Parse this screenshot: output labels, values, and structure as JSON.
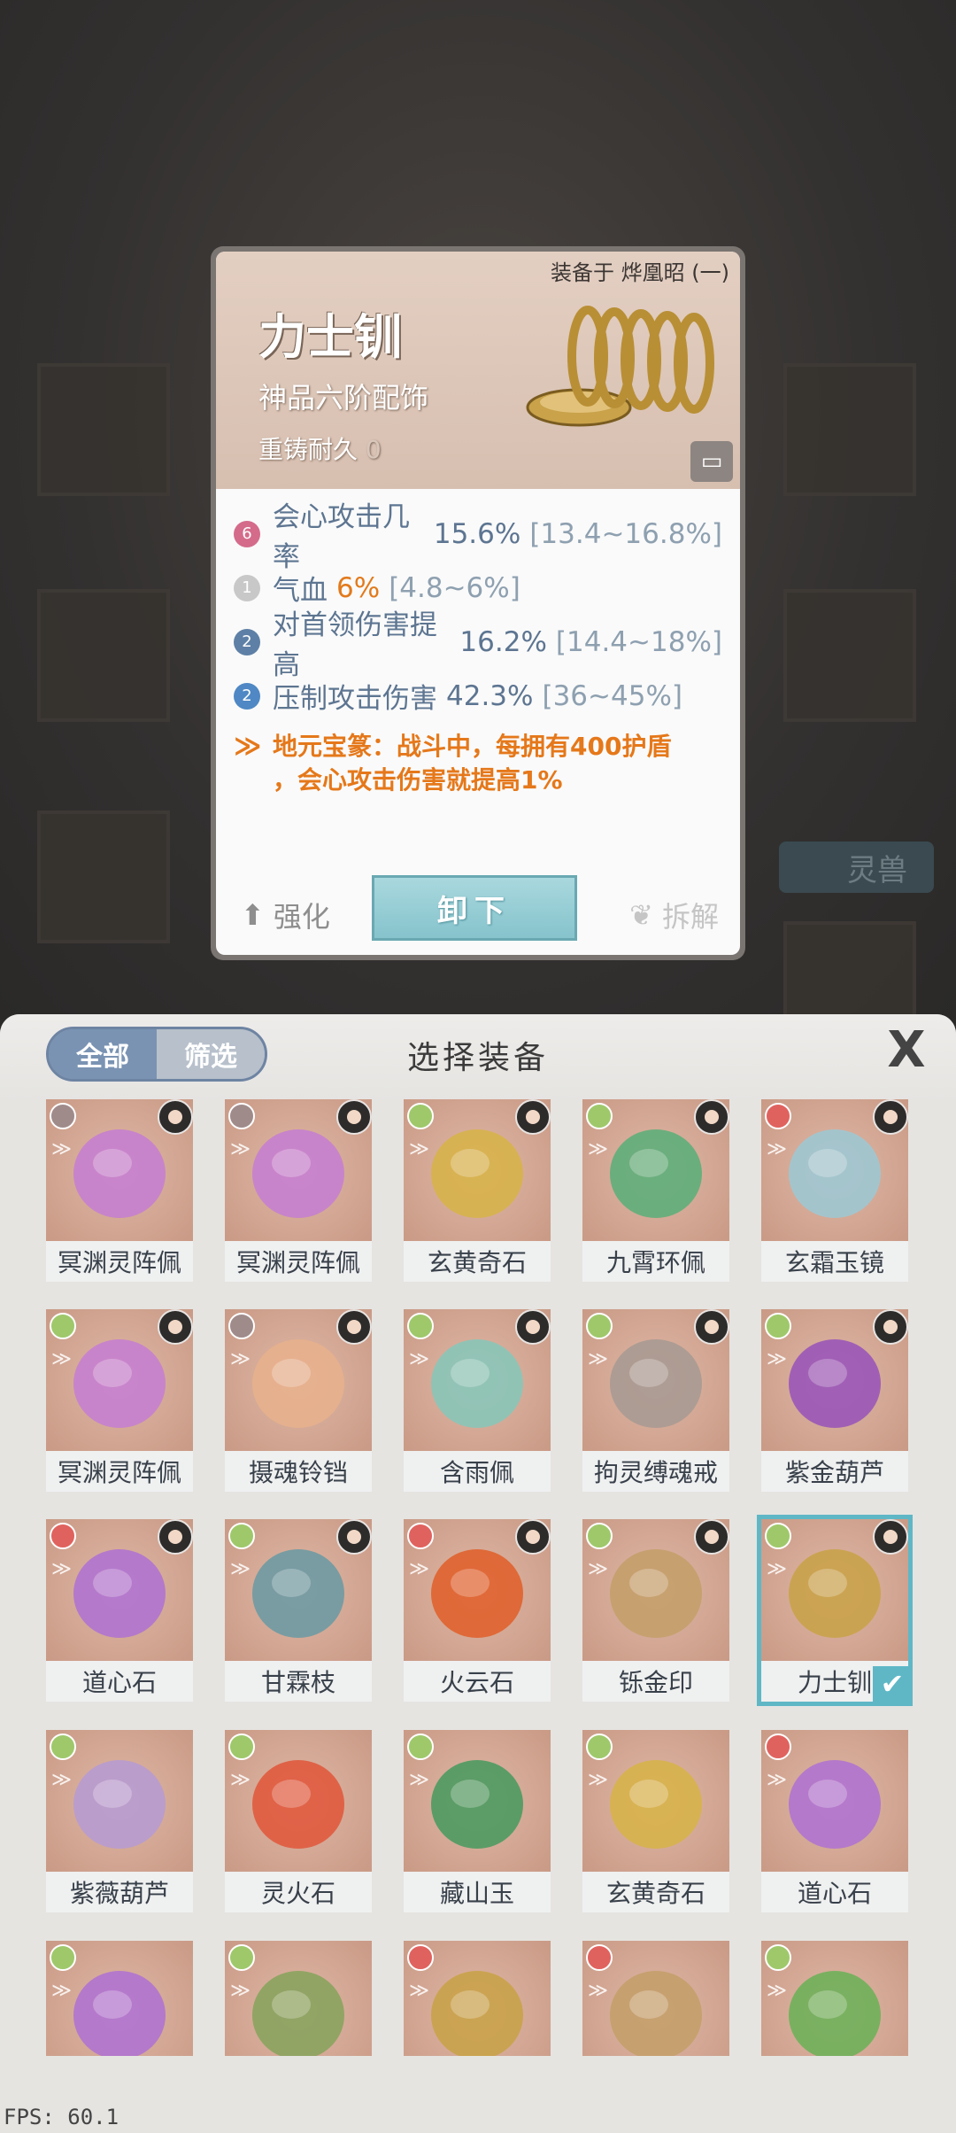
{
  "card": {
    "equipped_on": "装备于 烨凰昭 (一)",
    "name": "力士钏",
    "grade": "神品六阶配饰",
    "durability_label": "重铸耐久",
    "durability_value": "0",
    "stats": [
      {
        "badge": "6",
        "badge_color": "#d46b8b",
        "name": "会心攻击几率",
        "value": "15.6%",
        "range": "[13.4~16.8%]",
        "highlight": false
      },
      {
        "badge": "1",
        "badge_color": "#c8c8c8",
        "name": "气血",
        "value": "6%",
        "range": "[4.8~6%]",
        "highlight": true
      },
      {
        "badge": "2",
        "badge_color": "#5e80a6",
        "name": "对首领伤害提高",
        "value": "16.2%",
        "range": "[14.4~18%]",
        "highlight": false
      },
      {
        "badge": "2",
        "badge_color": "#4f88c4",
        "name": "压制攻击伤害",
        "value": "42.3%",
        "range": "[36~45%]",
        "highlight": false
      }
    ],
    "special_line1": "地元宝篆：战斗中，每拥有400护盾",
    "special_line2": "，会心攻击伤害就提高1%",
    "btn_strengthen": "强化",
    "btn_unequip": "卸下",
    "btn_dismantle": "拆解"
  },
  "background": {
    "pet_label": "灵兽"
  },
  "panel": {
    "tab_all": "全部",
    "tab_filter": "筛选",
    "title": "选择装备",
    "close": "X",
    "items": [
      {
        "name": "冥渊灵阵佩",
        "q": "#a08b8b",
        "art": "#c57fcf",
        "owner": true,
        "chest": false
      },
      {
        "name": "冥渊灵阵佩",
        "q": "#a08b8b",
        "art": "#c57fcf",
        "owner": true,
        "chest": false
      },
      {
        "name": "玄黄奇石",
        "q": "#9fc86b",
        "art": "#d7b24a",
        "owner": true,
        "chest": false
      },
      {
        "name": "九霄环佩",
        "q": "#9fc86b",
        "art": "#5fae7a",
        "owner": true,
        "chest": false
      },
      {
        "name": "玄霜玉镜",
        "q": "#e0625e",
        "art": "#9ec7d2",
        "owner": true,
        "chest": false
      },
      {
        "name": "冥渊灵阵佩",
        "q": "#9fc86b",
        "art": "#c57fcf",
        "owner": true,
        "chest": false
      },
      {
        "name": "摄魂铃铛",
        "q": "#a08b8b",
        "art": "#e7b08d",
        "owner": true,
        "chest": false
      },
      {
        "name": "含雨佩",
        "q": "#9fc86b",
        "art": "#8ac5b8",
        "owner": true,
        "chest": false
      },
      {
        "name": "拘灵缚魂戒",
        "q": "#9fc86b",
        "art": "#a89a92",
        "owner": true,
        "chest": false
      },
      {
        "name": "紫金葫芦",
        "q": "#9fc86b",
        "art": "#9a56b8",
        "owner": true,
        "chest": true
      },
      {
        "name": "道心石",
        "q": "#e0625e",
        "art": "#b073d0",
        "owner": true,
        "chest": false
      },
      {
        "name": "甘霖枝",
        "q": "#9fc86b",
        "art": "#6e9aa3",
        "owner": true,
        "chest": false
      },
      {
        "name": "火云石",
        "q": "#e0625e",
        "art": "#e0622e",
        "owner": true,
        "chest": true
      },
      {
        "name": "铄金印",
        "q": "#9fc86b",
        "art": "#c49e6a",
        "owner": true,
        "chest": false
      },
      {
        "name": "力士钏",
        "q": "#9fc86b",
        "art": "#c9a24a",
        "owner": true,
        "chest": true,
        "selected": true
      },
      {
        "name": "紫薇葫芦",
        "q": "#9fc86b",
        "art": "#b79bd0",
        "owner": false,
        "chest": false
      },
      {
        "name": "灵火石",
        "q": "#9fc86b",
        "art": "#e05a3e",
        "owner": false,
        "chest": false
      },
      {
        "name": "藏山玉",
        "q": "#9fc86b",
        "art": "#4e9a60",
        "owner": false,
        "chest": false
      },
      {
        "name": "玄黄奇石",
        "q": "#9fc86b",
        "art": "#d7b24a",
        "owner": false,
        "chest": false
      },
      {
        "name": "道心石",
        "q": "#e0625e",
        "art": "#b073d0",
        "owner": false,
        "chest": false
      },
      {
        "name": "",
        "q": "#9fc86b",
        "art": "#b073d0",
        "owner": false,
        "chest": false,
        "cut": true
      },
      {
        "name": "",
        "q": "#9fc86b",
        "art": "#8aa35e",
        "owner": false,
        "chest": false,
        "cut": true
      },
      {
        "name": "",
        "q": "#e0625e",
        "art": "#c9a24a",
        "owner": false,
        "chest": false,
        "cut": true
      },
      {
        "name": "",
        "q": "#e0625e",
        "art": "#c49e6a",
        "owner": false,
        "chest": false,
        "cut": true
      },
      {
        "name": "",
        "q": "#9fc86b",
        "art": "#6fb05a",
        "owner": false,
        "chest": false,
        "cut": true
      }
    ]
  },
  "fps": "FPS: 60.1"
}
